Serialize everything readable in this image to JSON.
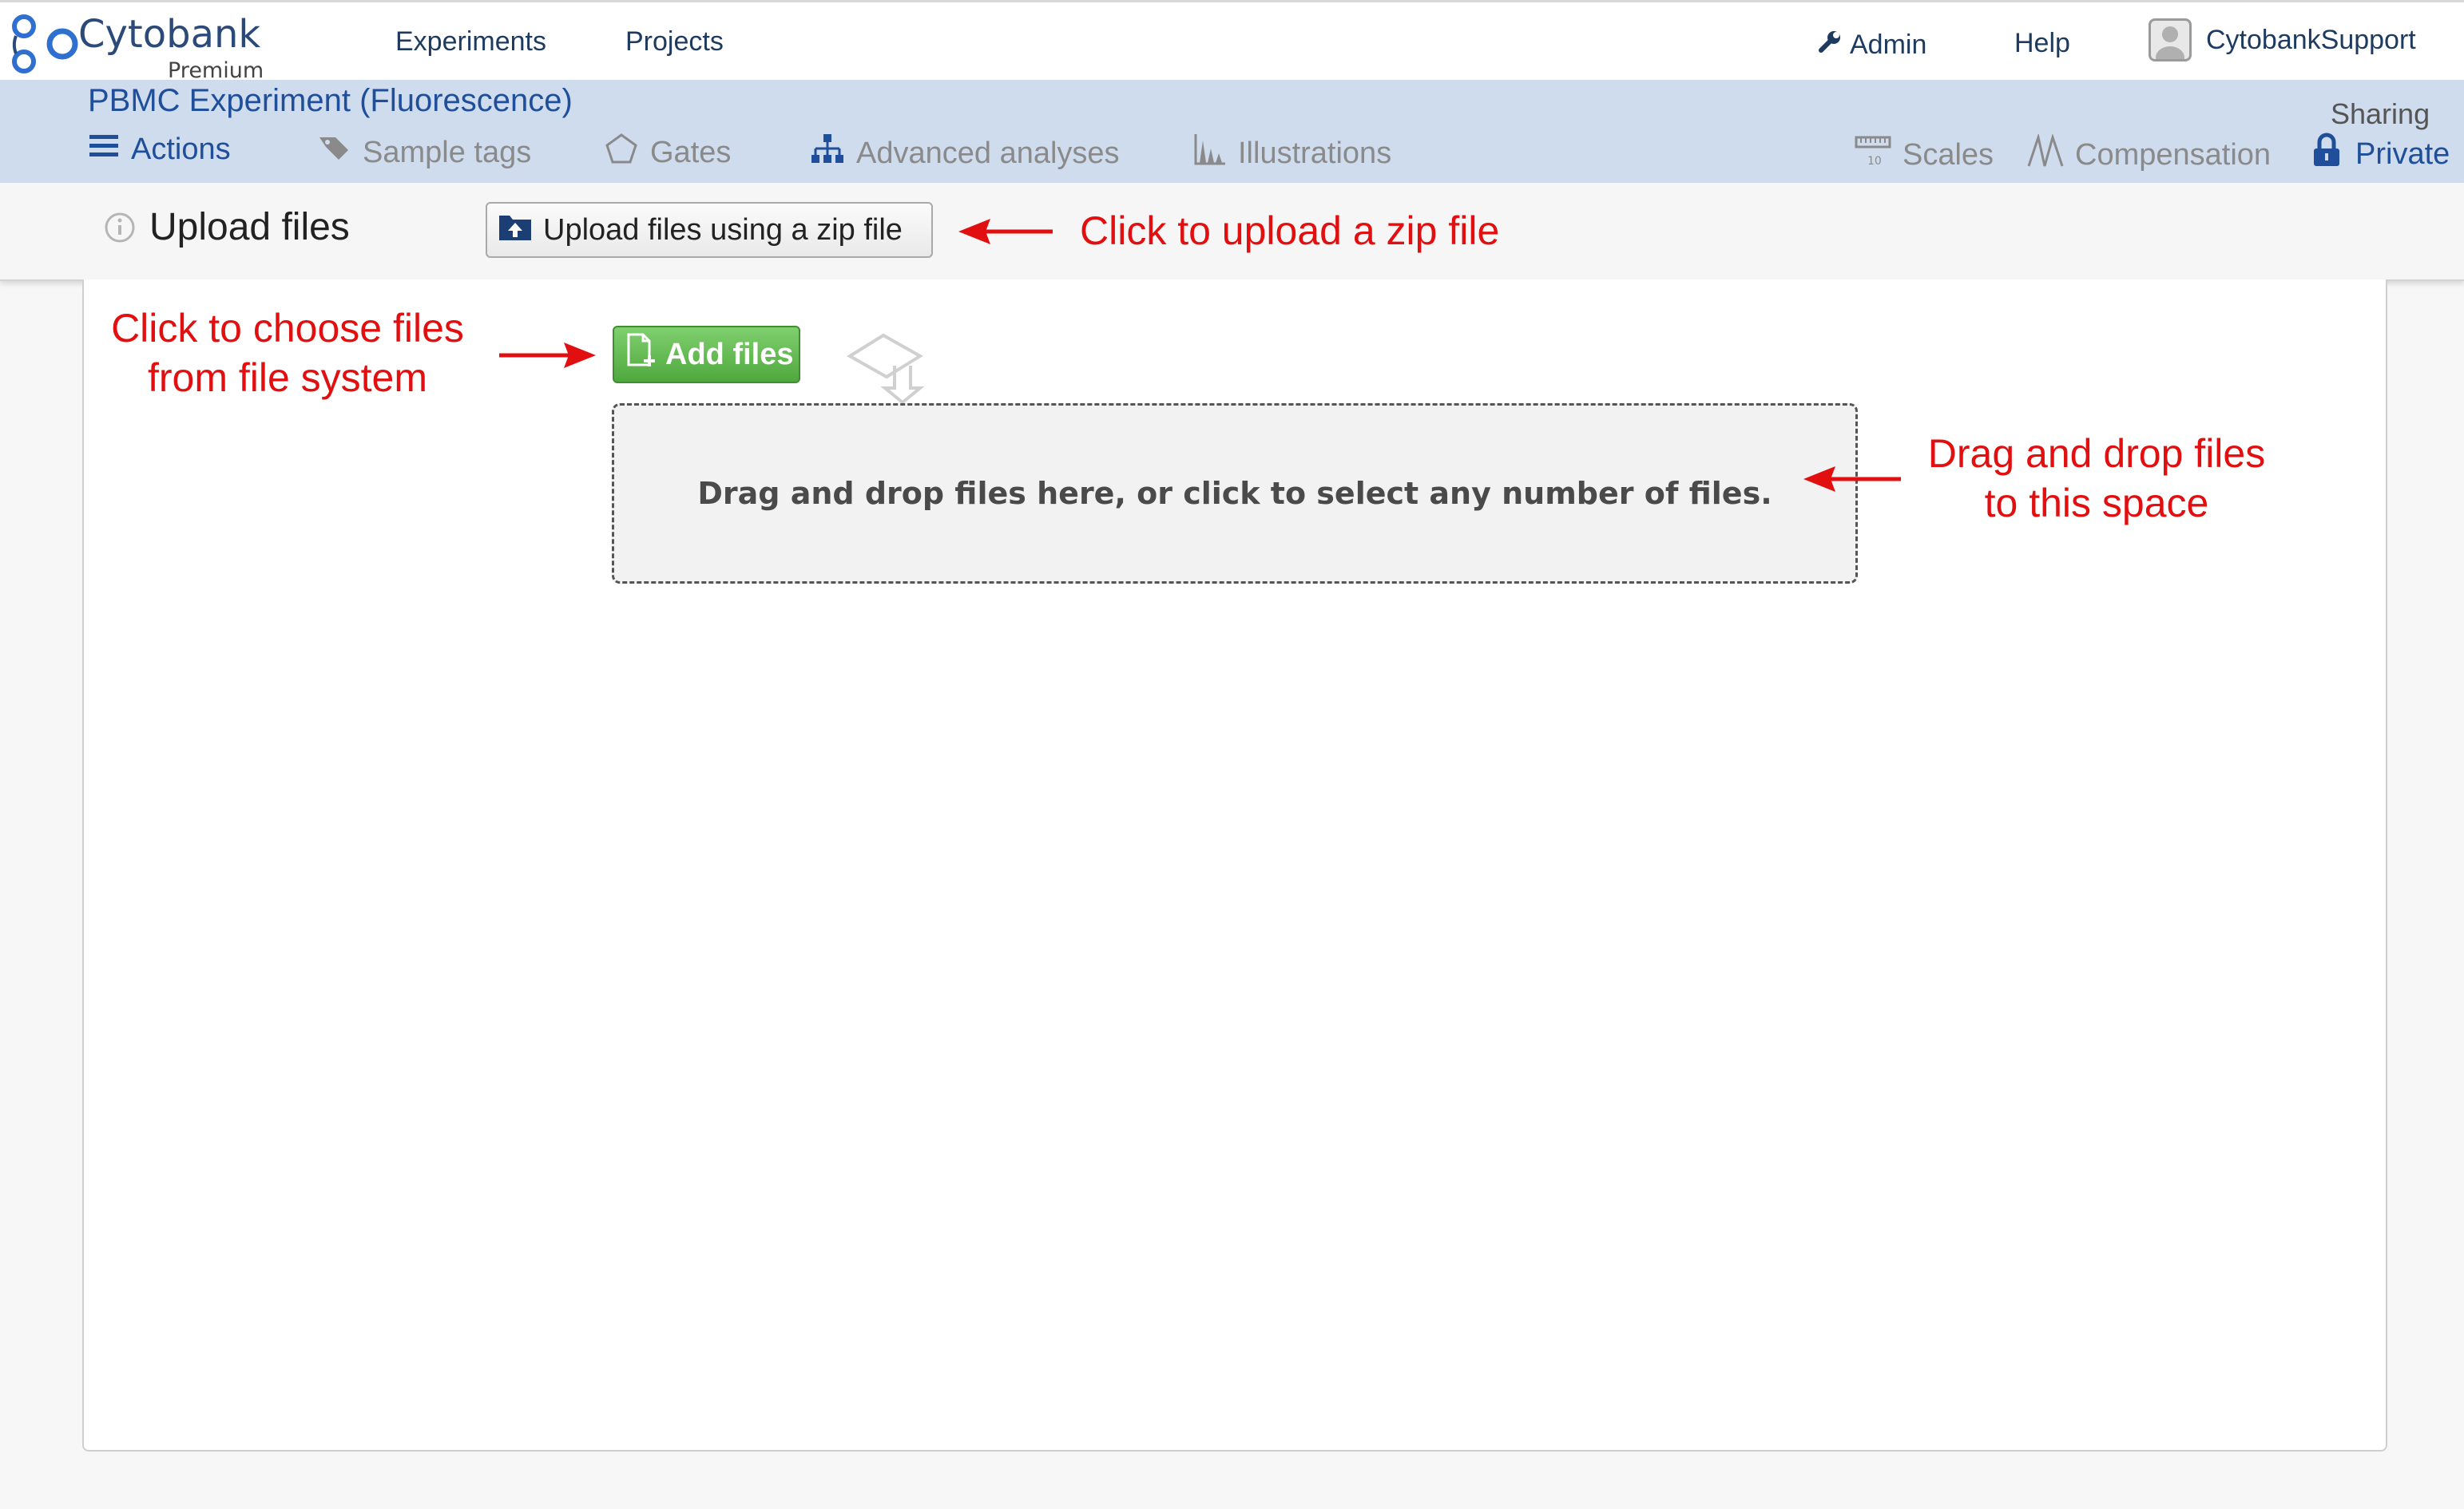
{
  "header": {
    "brand": "Cytobank",
    "brand_tier": "Premium",
    "nav": [
      "Experiments",
      "Projects"
    ],
    "admin_label": "Admin",
    "help_label": "Help",
    "user_name": "CytobankSupport"
  },
  "experiment": {
    "title": "PBMC Experiment (Fluorescence)",
    "tabs": [
      "Actions",
      "Sample tags",
      "Gates",
      "Advanced analyses",
      "Illustrations"
    ],
    "right_tabs": [
      "Scales",
      "Compensation"
    ],
    "sharing_label": "Sharing",
    "sharing_value": "Private"
  },
  "toolbar": {
    "title": "Upload files",
    "zip_button": "Upload files using a zip file"
  },
  "upload": {
    "add_files_button": "Add files",
    "dropzone_text": "Drag and drop files here, or click to select any number of files."
  },
  "annotations": {
    "zip": "Click to upload a zip file",
    "choose_line1": "Click to choose files",
    "choose_line2": "from file system",
    "drag_line1": "Drag and drop files",
    "drag_line2": "to this space"
  },
  "colors": {
    "accent": "#1f4f9a",
    "nav_bar": "#cfdcee",
    "annotation": "#e10f0f",
    "add_button": "#5cb84a"
  }
}
